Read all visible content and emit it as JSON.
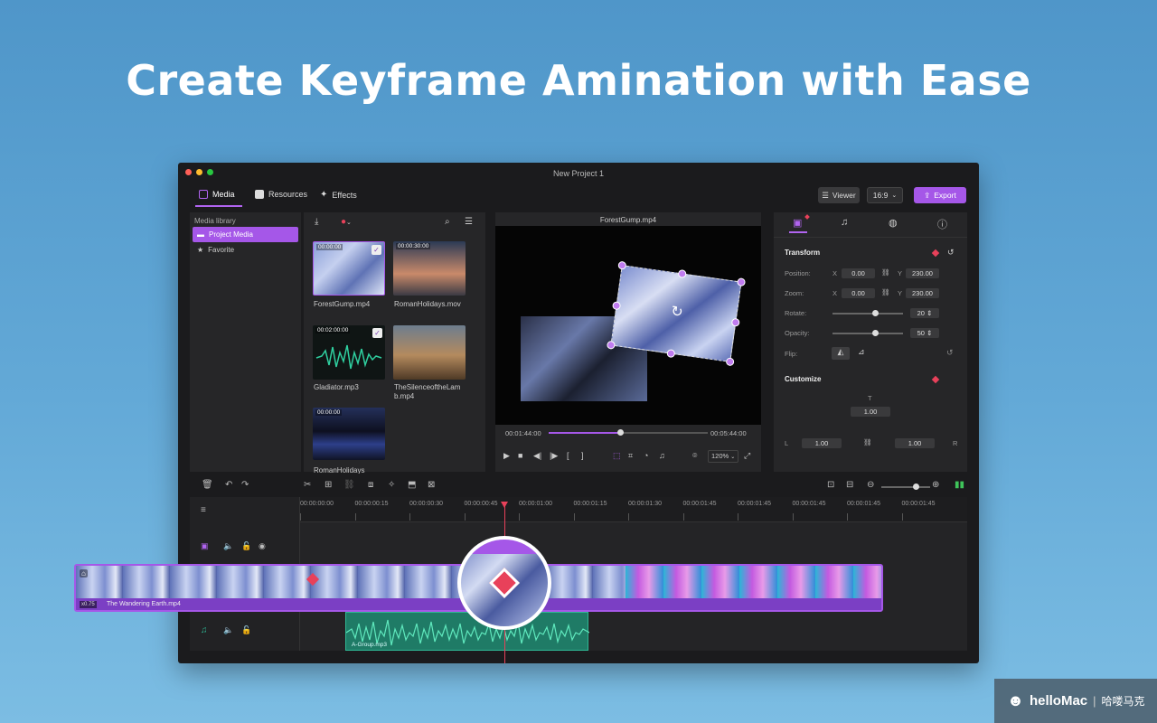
{
  "headline": "Create Keyframe Amination with Ease",
  "window": {
    "title": "New Project 1"
  },
  "toolbar": {
    "tabs": [
      {
        "label": "Media",
        "icon": "media-icon"
      },
      {
        "label": "Resources",
        "icon": "resources-icon"
      },
      {
        "label": "Effects",
        "icon": "effects-icon"
      }
    ],
    "viewer_label": "Viewer",
    "ratio_label": "16:9",
    "export_label": "Export"
  },
  "sidebar": {
    "heading": "Media library",
    "items": [
      {
        "label": "Project Media",
        "icon": "folder-icon",
        "selected": true
      },
      {
        "label": "Favorite",
        "icon": "star-icon",
        "selected": false
      }
    ]
  },
  "media": {
    "items": [
      {
        "name": "ForestGump.mp4",
        "duration": "00:00:00"
      },
      {
        "name": "RomanHolidays.mov",
        "duration": "00:00:30:00"
      },
      {
        "name": "Gladiator.mp3",
        "duration": "00:02:00:00"
      },
      {
        "name": "TheSilenceoftheLamb.mp4",
        "name_line1": "TheSilenceoftheLam",
        "name_line2": "b.mp4"
      },
      {
        "name": "RomanHolidays",
        "duration": "00:00:00"
      }
    ]
  },
  "viewer": {
    "title": "ForestGump.mp4",
    "time_current": "00:01:44:00",
    "time_total": "00:05:44:00",
    "zoom": "120%",
    "progress": 0.45
  },
  "inspector": {
    "transform_title": "Transform",
    "position_label": "Position:",
    "position_x": "0.00",
    "position_y": "230.00",
    "zoom_label": "Zoom:",
    "zoom_x": "0.00",
    "zoom_y": "230.00",
    "rotate_label": "Rotate:",
    "rotate_value": "20",
    "rotate_level": 0.6,
    "opacity_label": "Opacity:",
    "opacity_value": "50",
    "opacity_level": 0.6,
    "flip_label": "Flip:",
    "x_label": "X",
    "y_label": "Y",
    "customize_title": "Customize",
    "t_label": "T",
    "t_value": "1.00",
    "l_label": "L",
    "l_value": "1.00",
    "r_label": "R",
    "r_value": "1.00"
  },
  "timeline": {
    "ruler": [
      "00:00:00:00",
      "00:00:00:15",
      "00:00:00:30",
      "00:00:00:45",
      "00:00:01:00",
      "00:00:01:15",
      "00:00:01:30",
      "00:00:01:45",
      "00:00:01:45",
      "00:00:01:45",
      "00:00:01:45",
      "00:00:01:45"
    ],
    "video_clip_name": "The Wandering Earth.mp4",
    "video_clip_speed": "x0.75",
    "audio_clip_name": "A-Group.mp3",
    "zoom_level": 0.7
  },
  "watermark": {
    "brand": "helloMac",
    "chinese": "哈喽马克"
  },
  "colors": {
    "accent": "#a557e8",
    "keyframe": "#e8415a",
    "audio": "#2fb894"
  }
}
